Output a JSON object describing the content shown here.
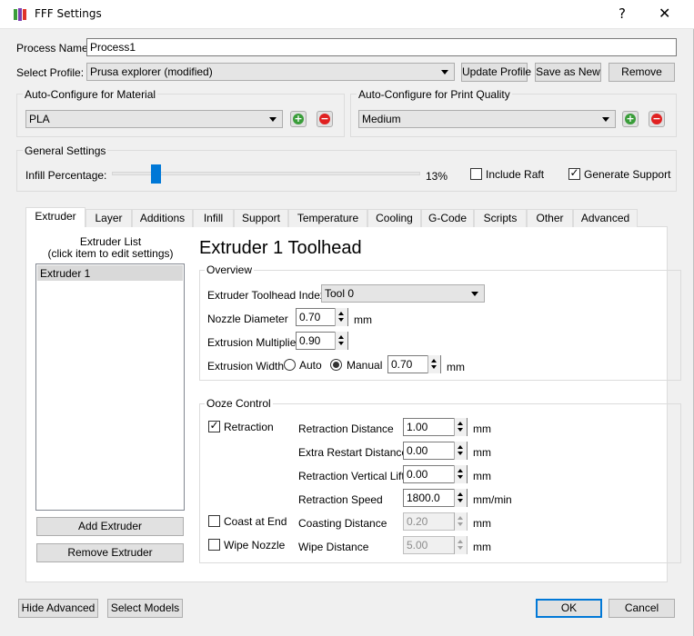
{
  "window": {
    "title": "FFF Settings",
    "help": "?",
    "close": "✕"
  },
  "process": {
    "name_label": "Process Name:",
    "name_value": "Process1"
  },
  "profile": {
    "label": "Select Profile:",
    "value": "Prusa explorer (modified)",
    "update_btn": "Update Profile",
    "save_btn": "Save as New",
    "remove_btn": "Remove"
  },
  "material": {
    "group_title": "Auto-Configure for Material",
    "value": "PLA"
  },
  "quality": {
    "group_title": "Auto-Configure for Print Quality",
    "value": "Medium"
  },
  "general": {
    "group_title": "General Settings",
    "infill_label": "Infill Percentage:",
    "infill_value": "13%",
    "infill_fraction": 0.13,
    "raft_label": "Include Raft",
    "raft_checked": false,
    "support_label": "Generate Support",
    "support_checked": true
  },
  "tabs": [
    "Extruder",
    "Layer",
    "Additions",
    "Infill",
    "Support",
    "Temperature",
    "Cooling",
    "G-Code",
    "Scripts",
    "Other",
    "Advanced"
  ],
  "extruder_list": {
    "title_line1": "Extruder List",
    "title_line2": "(click item to edit settings)",
    "items": [
      "Extruder 1"
    ],
    "add_btn": "Add Extruder",
    "remove_btn": "Remove Extruder"
  },
  "toolhead": {
    "heading": "Extruder 1 Toolhead",
    "overview": {
      "title": "Overview",
      "index_label": "Extruder Toolhead Index",
      "index_value": "Tool 0",
      "nozzle_label": "Nozzle Diameter",
      "nozzle_value": "0.70",
      "nozzle_unit": "mm",
      "mult_label": "Extrusion Multiplier",
      "mult_value": "0.90",
      "width_label": "Extrusion Width",
      "auto_label": "Auto",
      "manual_label": "Manual",
      "width_mode": "Manual",
      "width_value": "0.70",
      "width_unit": "mm"
    },
    "ooze": {
      "title": "Ooze Control",
      "retraction_label": "Retraction",
      "retraction_checked": true,
      "coast_label": "Coast at End",
      "coast_checked": false,
      "wipe_label": "Wipe Nozzle",
      "wipe_checked": false,
      "fields": [
        {
          "label": "Retraction Distance",
          "value": "1.00",
          "unit": "mm",
          "enabled": true
        },
        {
          "label": "Extra Restart Distance",
          "value": "0.00",
          "unit": "mm",
          "enabled": true
        },
        {
          "label": "Retraction Vertical Lift",
          "value": "0.00",
          "unit": "mm",
          "enabled": true
        },
        {
          "label": "Retraction Speed",
          "value": "1800.0",
          "unit": "mm/min",
          "enabled": true
        },
        {
          "label": "Coasting Distance",
          "value": "0.20",
          "unit": "mm",
          "enabled": false
        },
        {
          "label": "Wipe Distance",
          "value": "5.00",
          "unit": "mm",
          "enabled": false
        }
      ]
    }
  },
  "footer": {
    "hide_advanced": "Hide Advanced",
    "select_models": "Select Models",
    "ok": "OK",
    "cancel": "Cancel"
  },
  "colors": {
    "accent": "#0078d7",
    "add": "#3a9d3a",
    "remove": "#e02020"
  }
}
